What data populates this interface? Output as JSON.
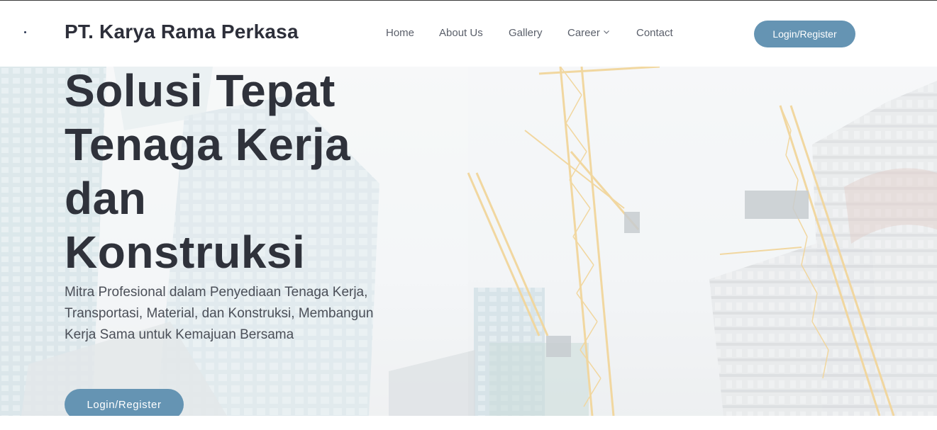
{
  "header": {
    "brand": "PT. Karya Rama Perkasa",
    "nav": {
      "home": "Home",
      "about": "About Us",
      "gallery": "Gallery",
      "career": "Career",
      "contact": "Contact"
    },
    "login_label": "Login/Register"
  },
  "hero": {
    "title_lines": [
      "Solusi Tepat",
      "Tenaga Kerja",
      "dan",
      "Konstruksi"
    ],
    "subtitle": "Mitra Profesional dalam Penyediaan Tenaga Kerja, Transportasi, Material, dan Konstruksi, Membangun Kerja Sama untuk Kemajuan Bersama",
    "cta_label": "Login/Register",
    "background_image": "construction cranes and skyscrapers (faded overlay)"
  },
  "colors": {
    "accent": "#6594b3",
    "title_text": "#2f323b",
    "nav_text": "#5a5f6a",
    "crane": "#e6b44a"
  }
}
